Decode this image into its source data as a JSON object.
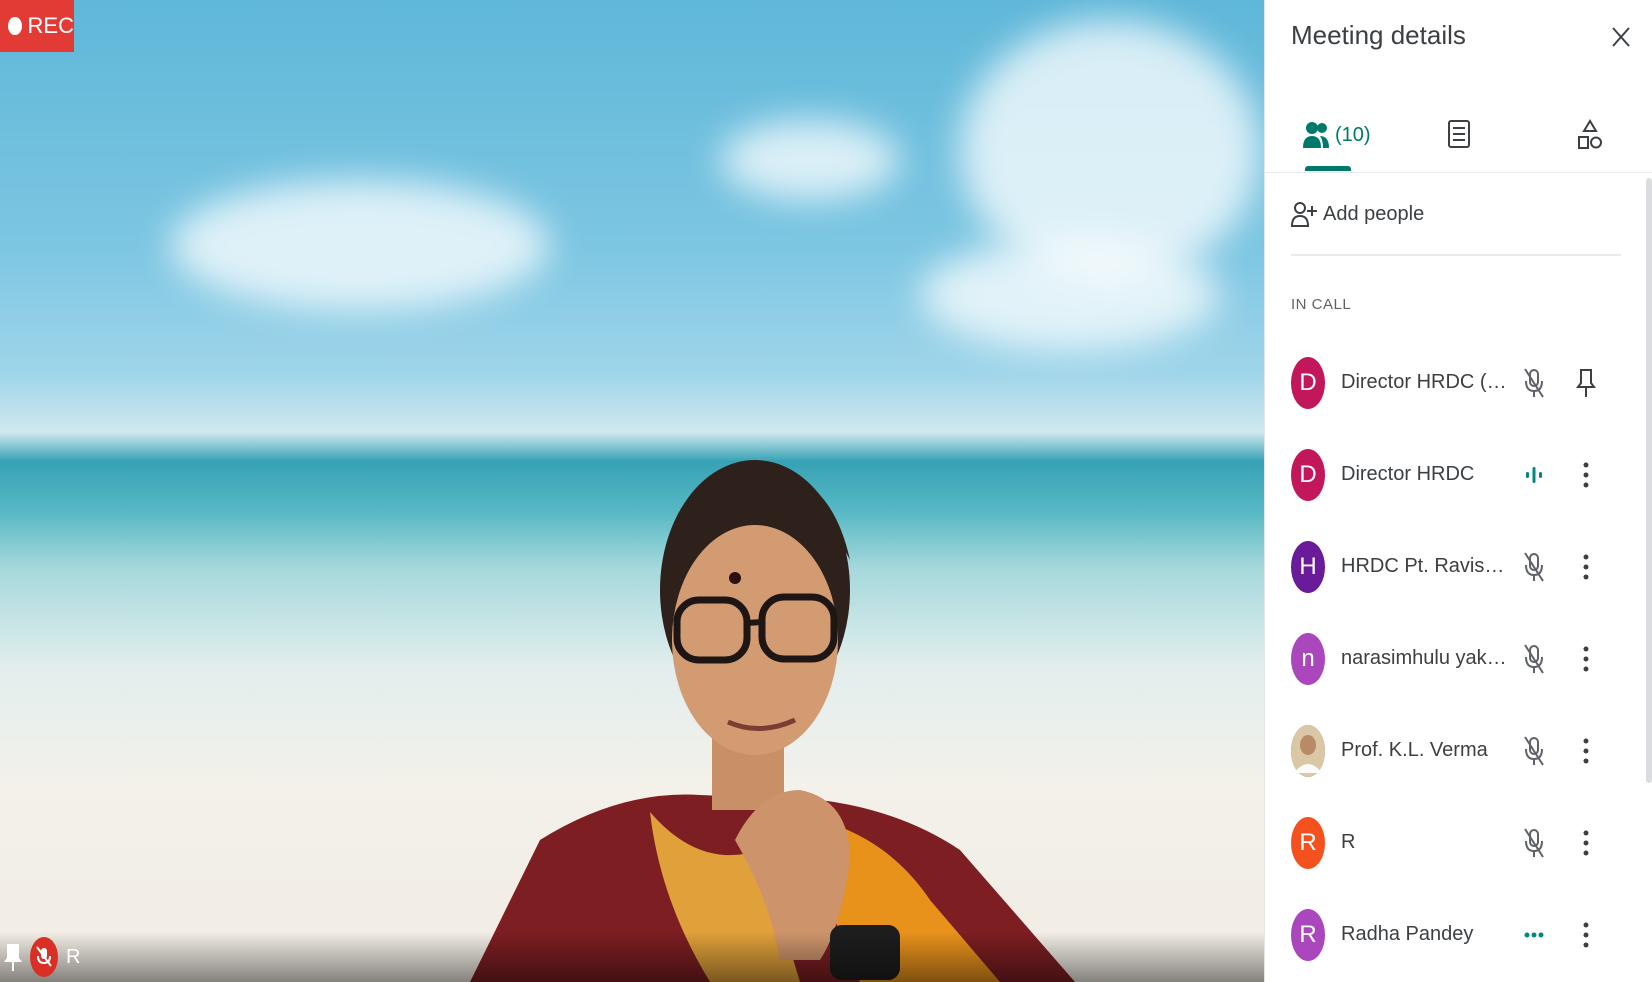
{
  "recording": {
    "label": "REC"
  },
  "tile": {
    "participant_initial": "R"
  },
  "panel": {
    "title": "Meeting details",
    "tabs": {
      "people_count": "(10)"
    },
    "add_people_label": "Add people",
    "section_label": "IN CALL",
    "participants": [
      {
        "initial": "D",
        "name": "Director HRDC (You)",
        "color": "#c2185b",
        "status_icon": "mic-off-icon",
        "action_icon": "pin-icon"
      },
      {
        "initial": "D",
        "name": "Director HRDC",
        "color": "#c2185b",
        "status_icon": "speaking-icon",
        "action_icon": "more-options-icon"
      },
      {
        "initial": "H",
        "name": "HRDC Pt. Ravishankar S...",
        "color": "#6a1b9a",
        "status_icon": "mic-off-icon",
        "action_icon": "more-options-icon"
      },
      {
        "initial": "n",
        "name": "narasimhulu yakkala",
        "color": "#ab47bc",
        "status_icon": "mic-off-icon",
        "action_icon": "more-options-icon"
      },
      {
        "initial": "",
        "name": "Prof. K.L. Verma",
        "color": "#8d6e63",
        "status_icon": "mic-off-icon",
        "action_icon": "more-options-icon"
      },
      {
        "initial": "R",
        "name": "R",
        "color": "#f4511e",
        "status_icon": "mic-off-icon",
        "action_icon": "more-options-icon"
      },
      {
        "initial": "R",
        "name": "Radha Pandey",
        "color": "#ab47bc",
        "status_icon": "speaking-dots-icon",
        "action_icon": "more-options-icon"
      }
    ]
  },
  "colors": {
    "accent": "#00796b",
    "rec": "#e23b35"
  }
}
